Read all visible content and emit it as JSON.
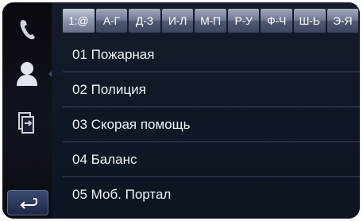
{
  "sidebar": {
    "items": [
      {
        "icon": "phone-icon"
      },
      {
        "icon": "contacts-icon",
        "active": true
      },
      {
        "icon": "transfer-icon"
      }
    ],
    "back_icon": "back-arrow-icon"
  },
  "tabs": [
    {
      "label": "1:@"
    },
    {
      "label": "А-Г"
    },
    {
      "label": "Д-З"
    },
    {
      "label": "И-Л"
    },
    {
      "label": "М-П"
    },
    {
      "label": "Р-У"
    },
    {
      "label": "Ф-Ч"
    },
    {
      "label": "Ш-Ь"
    },
    {
      "label": "Э-Я"
    }
  ],
  "contacts": [
    {
      "label": "01 Пожарная"
    },
    {
      "label": "02 Полиция"
    },
    {
      "label": "03 Скорая помощь"
    },
    {
      "label": "04 Баланс"
    },
    {
      "label": "05 Моб. Портал"
    }
  ],
  "colors": {
    "accent": "#3a4a70",
    "text": "#f2f4f8"
  }
}
